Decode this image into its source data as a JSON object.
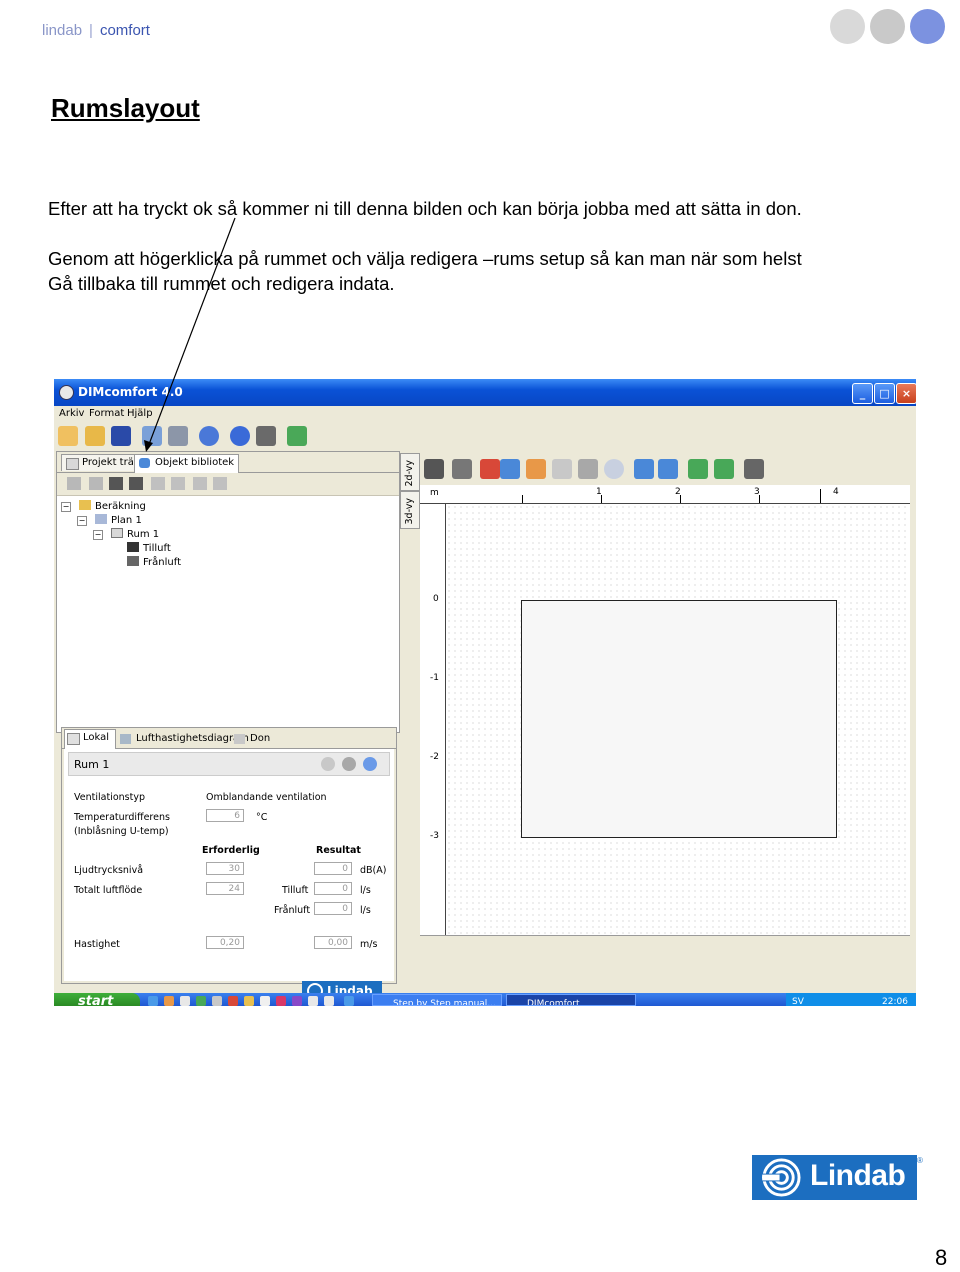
{
  "header": {
    "brand": "lindab",
    "separator": "|",
    "product": "comfort"
  },
  "colors": {
    "brand_blue": "#1c6ec0",
    "header_gray": "#8a96c8",
    "circle_1": "#d8d8d8",
    "circle_2": "#c8c8c8",
    "circle_3": "#7c92e0"
  },
  "page": {
    "title": "Rumslayout",
    "paragraph1": "Efter att ha tryckt ok så kommer ni till denna bilden och kan börja jobba med att sätta in don.",
    "paragraph2_line1": "Genom att högerklicka på rummet och välja redigera –rums setup så kan man när som helst",
    "paragraph2_line2": "Gå tillbaka till rummet och redigera indata.",
    "page_number": "8"
  },
  "app": {
    "window_title": "DIMcomfort 4.0",
    "menu": [
      "Arkiv",
      "Format",
      "Hjälp"
    ],
    "left_tabs": [
      "Projekt träd",
      "Objekt bibliotek"
    ],
    "tree": {
      "root": "Beräkning",
      "plan": "Plan 1",
      "room": "Rum 1",
      "supply": "Tilluft",
      "exhaust": "Frånluft"
    },
    "view_tabs": [
      "2d-vy",
      "3d-vy"
    ],
    "ruler": {
      "unit": "m",
      "x_labels": [
        "1",
        "2",
        "3",
        "4"
      ],
      "y_labels": [
        "0",
        "-1",
        "-2",
        "-3"
      ]
    },
    "lower_tabs": [
      "Lokal",
      "Lufthastighetsdiagram",
      "Don"
    ],
    "room_panel": {
      "room_name": "Rum 1",
      "vent_type_label": "Ventilationstyp",
      "vent_type_value": "Omblandande ventilation",
      "temp_label_1": "Temperaturdifferens",
      "temp_label_2": "(Inblåsning U-temp)",
      "temp_value": "6",
      "temp_unit": "°C",
      "col_required": "Erforderlig",
      "col_result": "Resultat",
      "sound_label": "Ljudtrycksnivå",
      "sound_required": "30",
      "sound_result": "0",
      "sound_unit": "dB(A)",
      "airflow_label": "Totalt luftflöde",
      "airflow_required": "24",
      "supply_label": "Tilluft",
      "supply_result": "0",
      "supply_unit": "l/s",
      "exhaust_label": "Frånluft",
      "exhaust_result": "0",
      "exhaust_unit": "l/s",
      "velocity_label": "Hastighet",
      "velocity_required": "0,20",
      "velocity_result": "0,00",
      "velocity_unit": "m/s",
      "logo_text": "Lindab"
    },
    "taskbar": {
      "start": "start",
      "items": [
        "Step by Step manual...",
        "DIMcomfort"
      ],
      "lang": "SV",
      "clock": "22:06"
    }
  },
  "footer_logo": {
    "text": "Lindab",
    "reg": "®"
  }
}
